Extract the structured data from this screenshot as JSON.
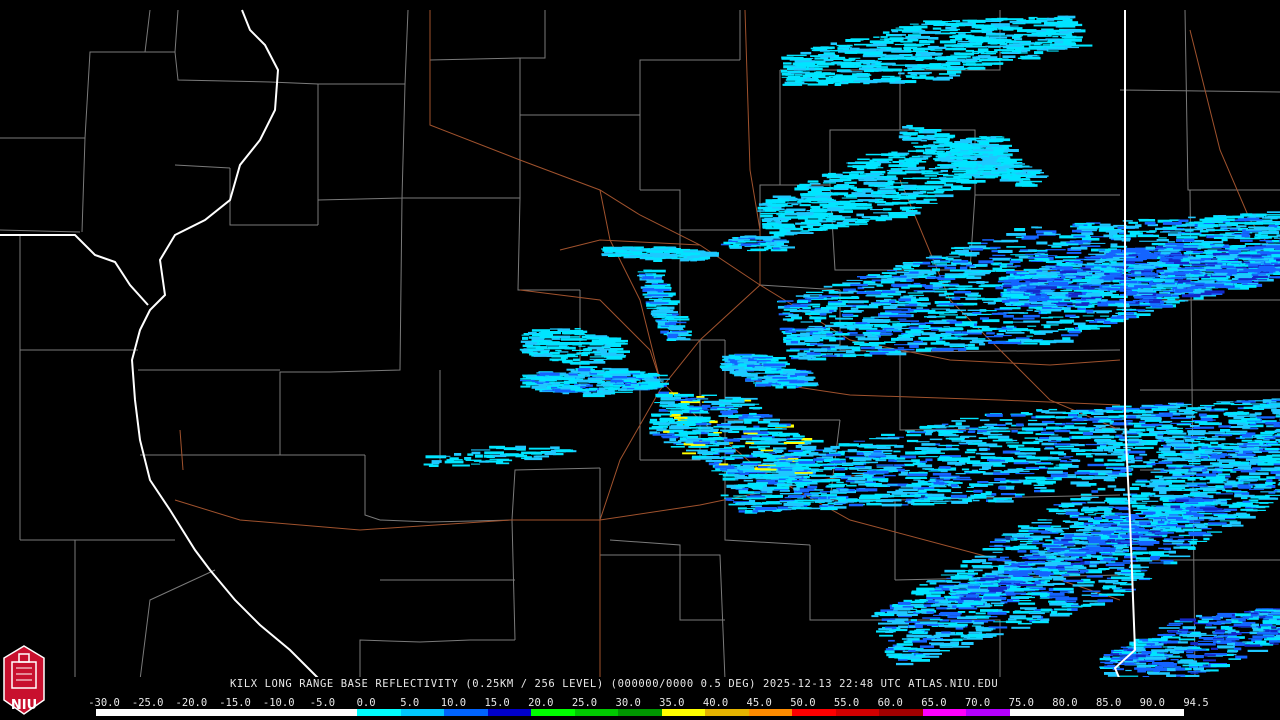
{
  "caption": "KILX LONG RANGE BASE REFLECTIVITY (0.25KM / 256 LEVEL) (000000/0000 0.5 DEG) 2025-12-13 22:48 UTC  ATLAS.NIU.EDU",
  "logo": {
    "text": "NIU"
  },
  "colors": {
    "background": "#000000",
    "county_lines": "#7a7a7a",
    "state_lines": "#ffffff",
    "highways": "#a0522d",
    "logo_red": "#c8102e"
  },
  "scale": {
    "labels": [
      "-30.0",
      "-25.0",
      "-20.0",
      "-15.0",
      "-10.0",
      "-5.0",
      "0.0",
      "5.0",
      "10.0",
      "15.0",
      "20.0",
      "25.0",
      "30.0",
      "35.0",
      "40.0",
      "45.0",
      "50.0",
      "55.0",
      "60.0",
      "65.0",
      "70.0",
      "75.0",
      "80.0",
      "85.0",
      "90.0",
      "94.5"
    ],
    "colors": [
      "#ffffff",
      "#ffffff",
      "#ffffff",
      "#ffffff",
      "#ffffff",
      "#ffffff",
      "#00ffff",
      "#00c8ff",
      "#0064ff",
      "#0000c8",
      "#00ff00",
      "#00c800",
      "#009600",
      "#ffff00",
      "#e6b400",
      "#ff8c00",
      "#ff0000",
      "#d20000",
      "#a00000",
      "#ff00ff",
      "#b400ff",
      "#ffffff",
      "#ffffff",
      "#ffffff",
      "#ffffff"
    ]
  },
  "echoes": {
    "levels": [
      "#00e5ff",
      "#1ec8ff",
      "#1464ff",
      "#1428c8",
      "#ffff00"
    ]
  }
}
